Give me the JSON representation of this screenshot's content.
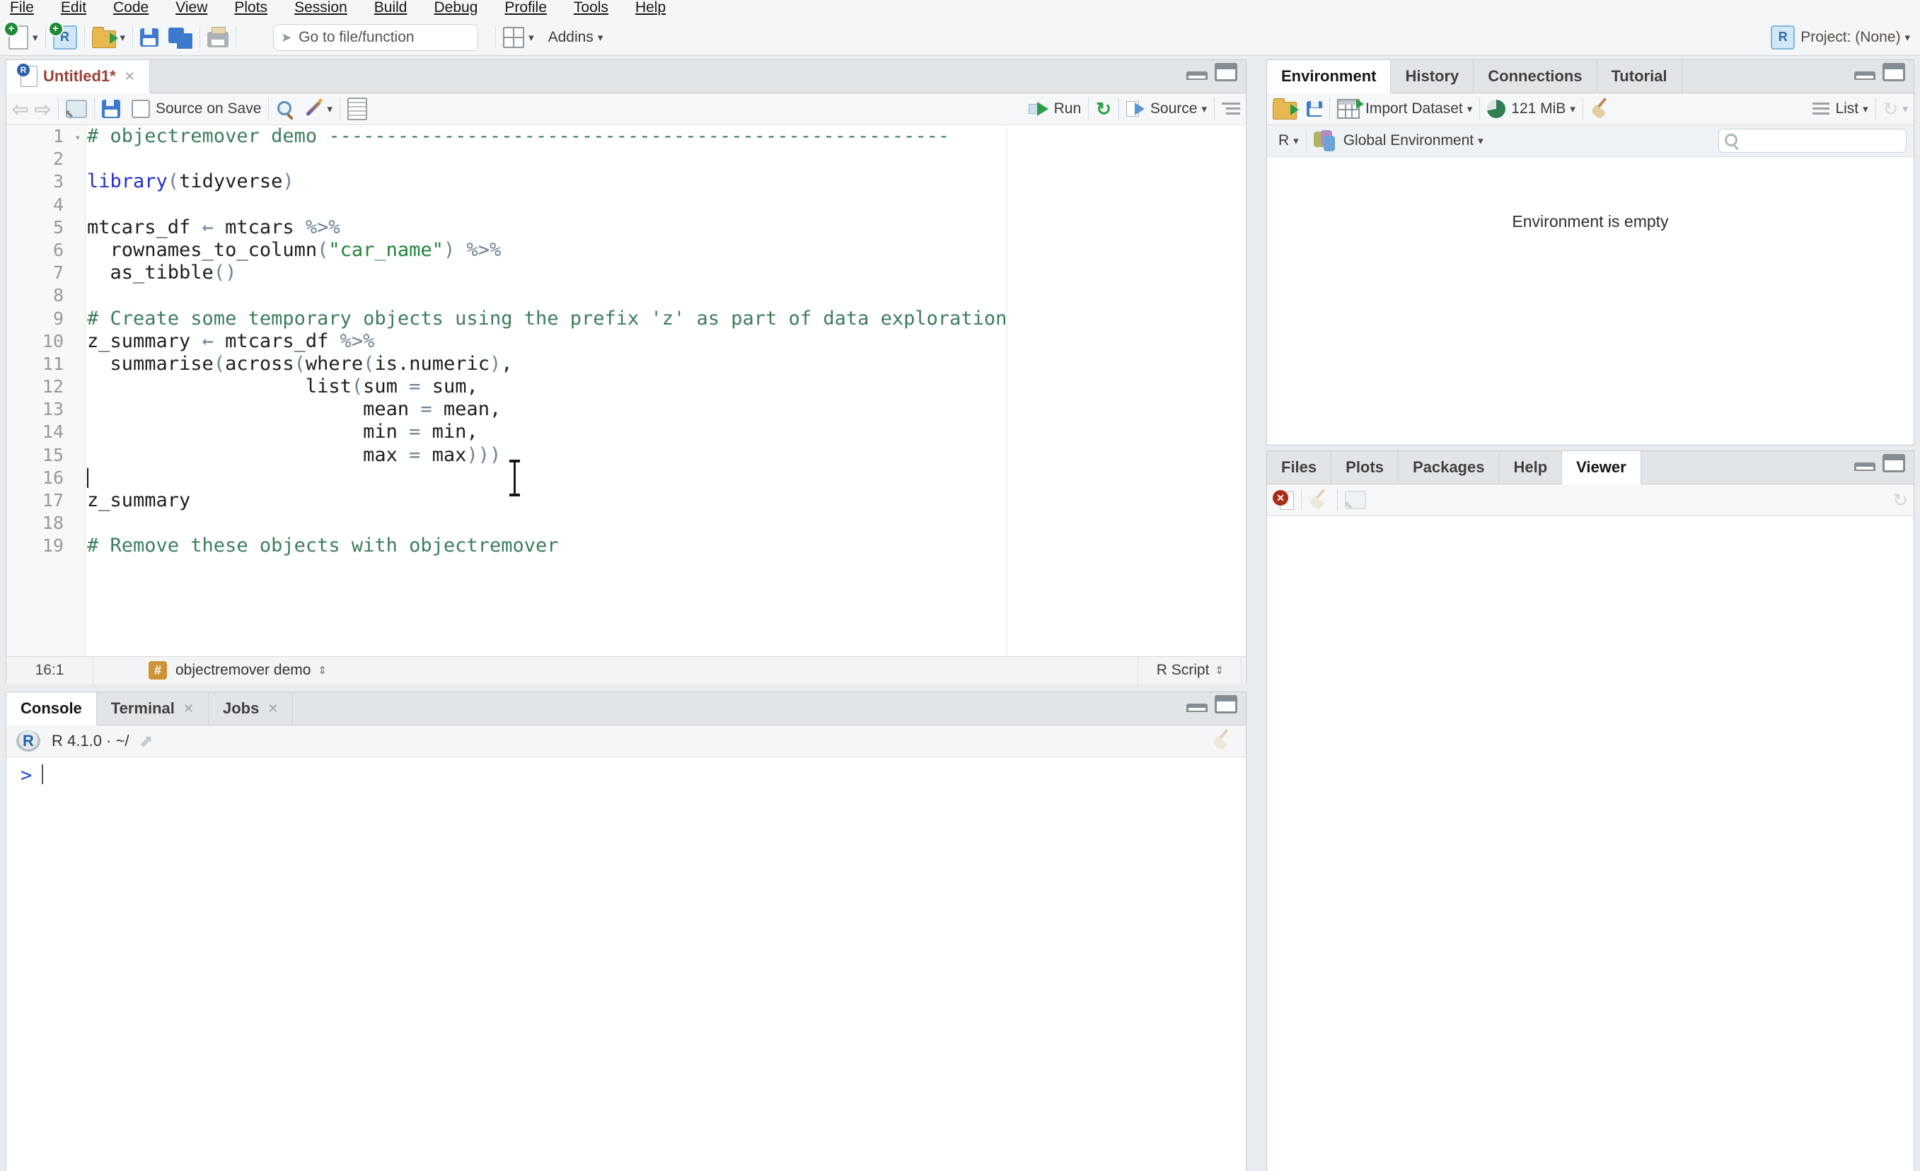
{
  "icons": {
    "caret": "▾",
    "updown": "⇕",
    "close": "✕",
    "back": "⇦",
    "forward": "⇨",
    "rerun": "↻",
    "refresh": "↻",
    "goto_arrow": "➤",
    "popout_arrow": "⬈"
  },
  "menu": {
    "items": [
      "File",
      "Edit",
      "Code",
      "View",
      "Plots",
      "Session",
      "Build",
      "Debug",
      "Profile",
      "Tools",
      "Help"
    ]
  },
  "toolbar": {
    "goto_placeholder": "Go to file/function",
    "addins_label": "Addins",
    "project_label": "Project: (None)"
  },
  "editor": {
    "tab": {
      "title": "Untitled1*"
    },
    "toolbar": {
      "source_on_save": "Source on Save",
      "run_label": "Run",
      "source_label": "Source"
    },
    "status": {
      "position": "16:1",
      "section": "objectremover demo",
      "file_type": "R Script"
    },
    "code": {
      "lines": [
        {
          "n": 1,
          "fold": true,
          "segs": [
            [
              "c",
              "# objectremover demo ------------------------------------------------------"
            ]
          ]
        },
        {
          "n": 2,
          "segs": []
        },
        {
          "n": 3,
          "segs": [
            [
              "k",
              "library"
            ],
            [
              "o",
              "("
            ],
            [
              "t",
              "tidyverse"
            ],
            [
              "o",
              ")"
            ]
          ]
        },
        {
          "n": 4,
          "segs": []
        },
        {
          "n": 5,
          "segs": [
            [
              "t",
              "mtcars_df "
            ],
            [
              "o",
              "← "
            ],
            [
              "t",
              "mtcars "
            ],
            [
              "o",
              "%>%"
            ]
          ]
        },
        {
          "n": 6,
          "segs": [
            [
              "t",
              "  rownames_to_column"
            ],
            [
              "o",
              "("
            ],
            [
              "s",
              "\"car_name\""
            ],
            [
              "o",
              ")"
            ],
            [
              "t",
              " "
            ],
            [
              "o",
              "%>%"
            ]
          ]
        },
        {
          "n": 7,
          "segs": [
            [
              "t",
              "  as_tibble"
            ],
            [
              "o",
              "()"
            ]
          ]
        },
        {
          "n": 8,
          "segs": []
        },
        {
          "n": 9,
          "segs": [
            [
              "c",
              "# Create some temporary objects using the prefix 'z' as part of data exploration"
            ]
          ]
        },
        {
          "n": 10,
          "segs": [
            [
              "t",
              "z_summary "
            ],
            [
              "o",
              "← "
            ],
            [
              "t",
              "mtcars_df "
            ],
            [
              "o",
              "%>%"
            ]
          ]
        },
        {
          "n": 11,
          "segs": [
            [
              "t",
              "  summarise"
            ],
            [
              "o",
              "("
            ],
            [
              "t",
              "across"
            ],
            [
              "o",
              "("
            ],
            [
              "t",
              "where"
            ],
            [
              "o",
              "("
            ],
            [
              "t",
              "is.numeric"
            ],
            [
              "o",
              ")"
            ],
            [
              "t",
              ","
            ]
          ]
        },
        {
          "n": 12,
          "segs": [
            [
              "t",
              "                   list"
            ],
            [
              "o",
              "("
            ],
            [
              "t",
              "sum "
            ],
            [
              "o",
              "= "
            ],
            [
              "t",
              "sum"
            ],
            [
              "t",
              ","
            ]
          ]
        },
        {
          "n": 13,
          "segs": [
            [
              "t",
              "                        mean "
            ],
            [
              "o",
              "= "
            ],
            [
              "t",
              "mean"
            ],
            [
              "t",
              ","
            ]
          ]
        },
        {
          "n": 14,
          "segs": [
            [
              "t",
              "                        min "
            ],
            [
              "o",
              "= "
            ],
            [
              "t",
              "min"
            ],
            [
              "t",
              ","
            ]
          ]
        },
        {
          "n": 15,
          "segs": [
            [
              "t",
              "                        max "
            ],
            [
              "o",
              "= "
            ],
            [
              "t",
              "max"
            ],
            [
              "o",
              ")))"
            ]
          ]
        },
        {
          "n": 16,
          "caret": true,
          "segs": []
        },
        {
          "n": 17,
          "segs": [
            [
              "t",
              "z_summary"
            ]
          ]
        },
        {
          "n": 18,
          "segs": []
        },
        {
          "n": 19,
          "segs": [
            [
              "c",
              "# Remove these objects with objectremover"
            ]
          ]
        }
      ]
    }
  },
  "console": {
    "tabs": [
      "Console",
      "Terminal",
      "Jobs"
    ],
    "r_version": "R 4.1.0  ·  ~/",
    "prompt": ">"
  },
  "environment": {
    "tabs": [
      "Environment",
      "History",
      "Connections",
      "Tutorial"
    ],
    "toolbar": {
      "import_label": "Import Dataset",
      "memory_label": "121 MiB",
      "list_label": "List"
    },
    "selector": {
      "lang": "R",
      "env_label": "Global Environment"
    },
    "empty_message": "Environment is empty"
  },
  "files_pane": {
    "tabs": [
      "Files",
      "Plots",
      "Packages",
      "Help",
      "Viewer"
    ]
  }
}
